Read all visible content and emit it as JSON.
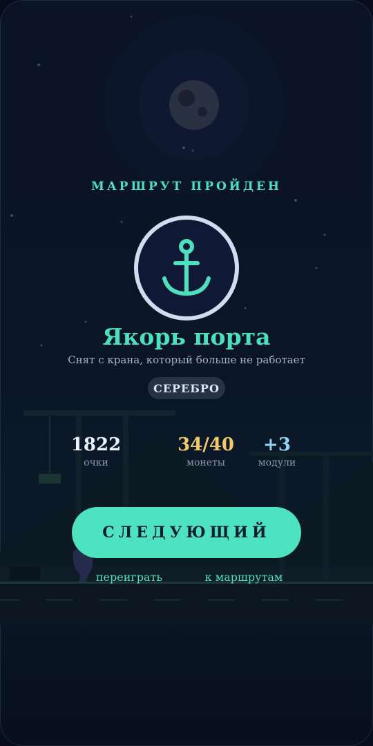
{
  "header": {
    "kicker": "МАРШРУТ ПРОЙДЕН"
  },
  "achievement": {
    "icon": "anchor-icon",
    "title": "Якорь порта",
    "description": "Снят с крана, который больше не работает",
    "tier": "СЕРЕБРО"
  },
  "stats": [
    {
      "value": "1822",
      "label": "очки",
      "color": "#eef2fa"
    },
    {
      "value": "34/40",
      "label": "монеты",
      "color": "#f3c866"
    },
    {
      "value": "+3",
      "label": "модули",
      "color": "#8fd3f4"
    }
  ],
  "actions": {
    "next_label": "СЛЕДУЮЩИЙ",
    "replay_label": "переиграть",
    "routes_label": "к маршрутам"
  },
  "colors": {
    "accent": "#4de0bd",
    "button": "#4de3c0",
    "background": "#0b1427",
    "badge_ring": "#d3dcef"
  }
}
